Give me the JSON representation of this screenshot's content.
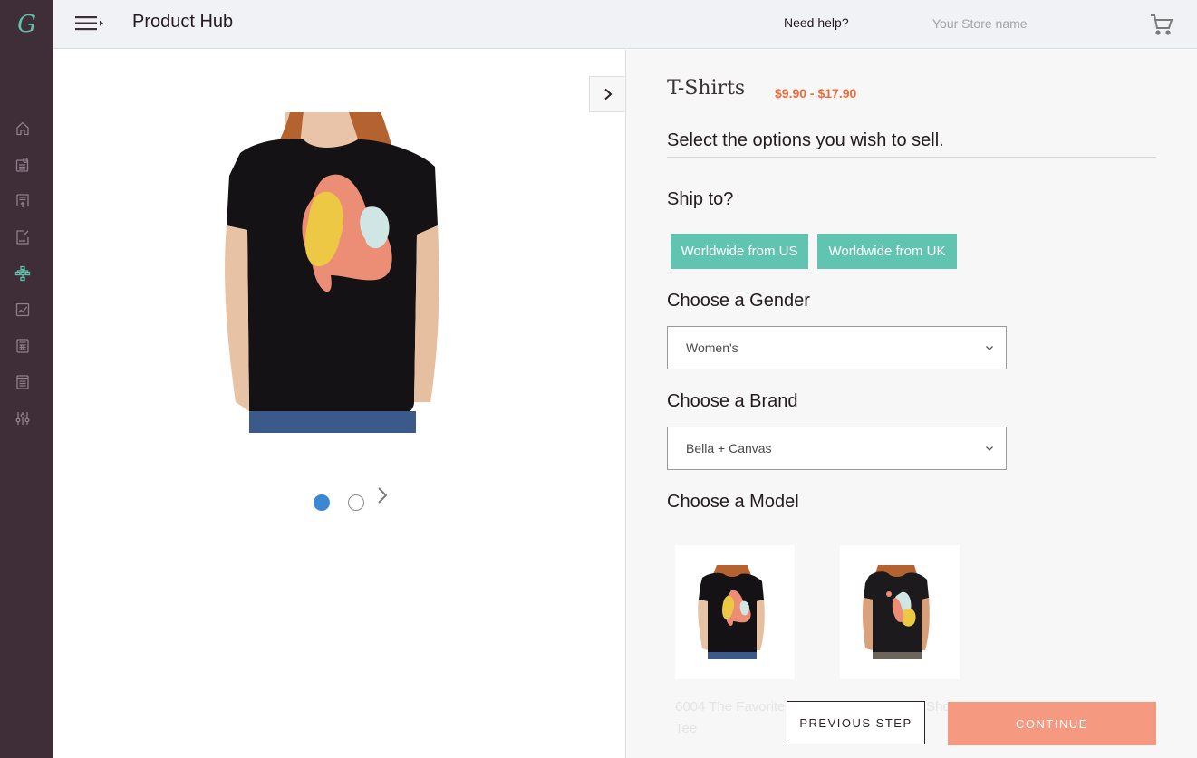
{
  "app": {
    "logo_glyph": "G",
    "title": "Product Hub"
  },
  "sidebar": {
    "items": [
      {
        "icon": "home-icon",
        "active": false
      },
      {
        "icon": "profile-card-icon",
        "active": false
      },
      {
        "icon": "upload-document-icon",
        "active": false
      },
      {
        "icon": "csv-import-icon",
        "active": false
      },
      {
        "icon": "product-hierarchy-icon",
        "active": true
      },
      {
        "icon": "analytics-chart-icon",
        "active": false
      },
      {
        "icon": "calculator-icon",
        "active": false
      },
      {
        "icon": "orders-list-icon",
        "active": false
      },
      {
        "icon": "settings-sliders-icon",
        "active": false
      }
    ]
  },
  "header": {
    "help_label": "Need help?",
    "store_placeholder": "Your Store name",
    "store_value": "",
    "cart_icon": "cart-icon"
  },
  "gallery": {
    "current_slide": 1,
    "total_slides": 2
  },
  "product": {
    "title": "T-Shirts",
    "price_range": "$9.90 - $17.90",
    "instructions": "Select the options you wish to sell."
  },
  "ship": {
    "heading": "Ship to?",
    "options": [
      "Worldwide from US",
      "Worldwide from UK"
    ]
  },
  "gender": {
    "heading": "Choose a Gender",
    "selected": "Women's"
  },
  "brand": {
    "heading": "Choose a Brand",
    "selected": "Bella + Canvas"
  },
  "model": {
    "heading": "Choose a Model",
    "items": [
      {
        "name_line1": "6004 The Favorite",
        "name_line2": "Tee"
      },
      {
        "name_line1": "8413 Triblend Short",
        "name_line2": ""
      }
    ]
  },
  "actions": {
    "previous": "PREVIOUS STEP",
    "continue": "CONTINUE"
  },
  "colors": {
    "sidebar_bg": "#3f2d38",
    "accent_teal": "#61c4b0",
    "price_orange": "#ef6a3a",
    "continue_salmon": "#f59a80",
    "dot_active": "#3b87d4"
  }
}
